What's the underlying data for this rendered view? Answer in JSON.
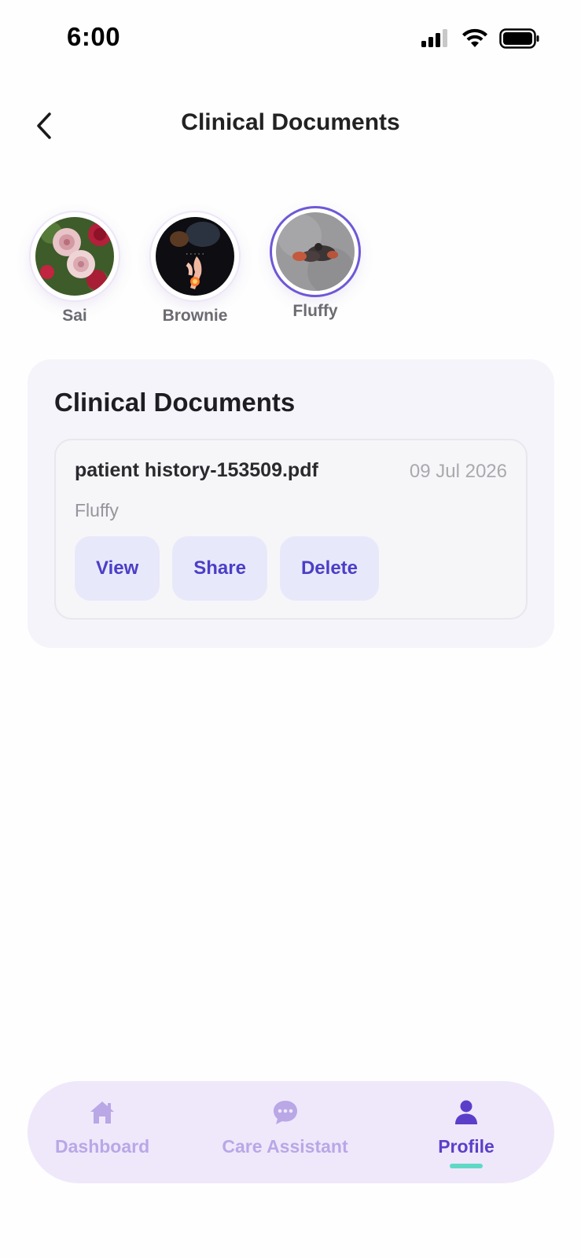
{
  "status_bar": {
    "time": "6:00"
  },
  "header": {
    "title": "Clinical Documents",
    "back_icon": "chevron-left-icon"
  },
  "pets": [
    {
      "name": "Sai",
      "photo": "roses",
      "selected": false
    },
    {
      "name": "Brownie",
      "photo": "hands-art",
      "selected": false
    },
    {
      "name": "Fluffy",
      "photo": "puppy-on-floor",
      "selected": true
    }
  ],
  "documents_section": {
    "title": "Clinical Documents",
    "documents": [
      {
        "file_name": "patient history-153509.pdf",
        "date": "09 Jul 2026",
        "pet": "Fluffy",
        "actions": {
          "view": "View",
          "share": "Share",
          "delete": "Delete"
        }
      }
    ]
  },
  "bottom_nav": {
    "items": [
      {
        "label": "Dashboard",
        "icon": "home-icon",
        "active": false
      },
      {
        "label": "Care Assistant",
        "icon": "chat-bubble-icon",
        "active": false
      },
      {
        "label": "Profile",
        "icon": "person-icon",
        "active": true
      }
    ]
  },
  "colors": {
    "accent": "#5b3fc9",
    "button_bg": "#e8e8fb",
    "nav_bg": "#efe8fb",
    "nav_indicator": "#5fd9c6",
    "card_bg": "#f5f4fa"
  }
}
